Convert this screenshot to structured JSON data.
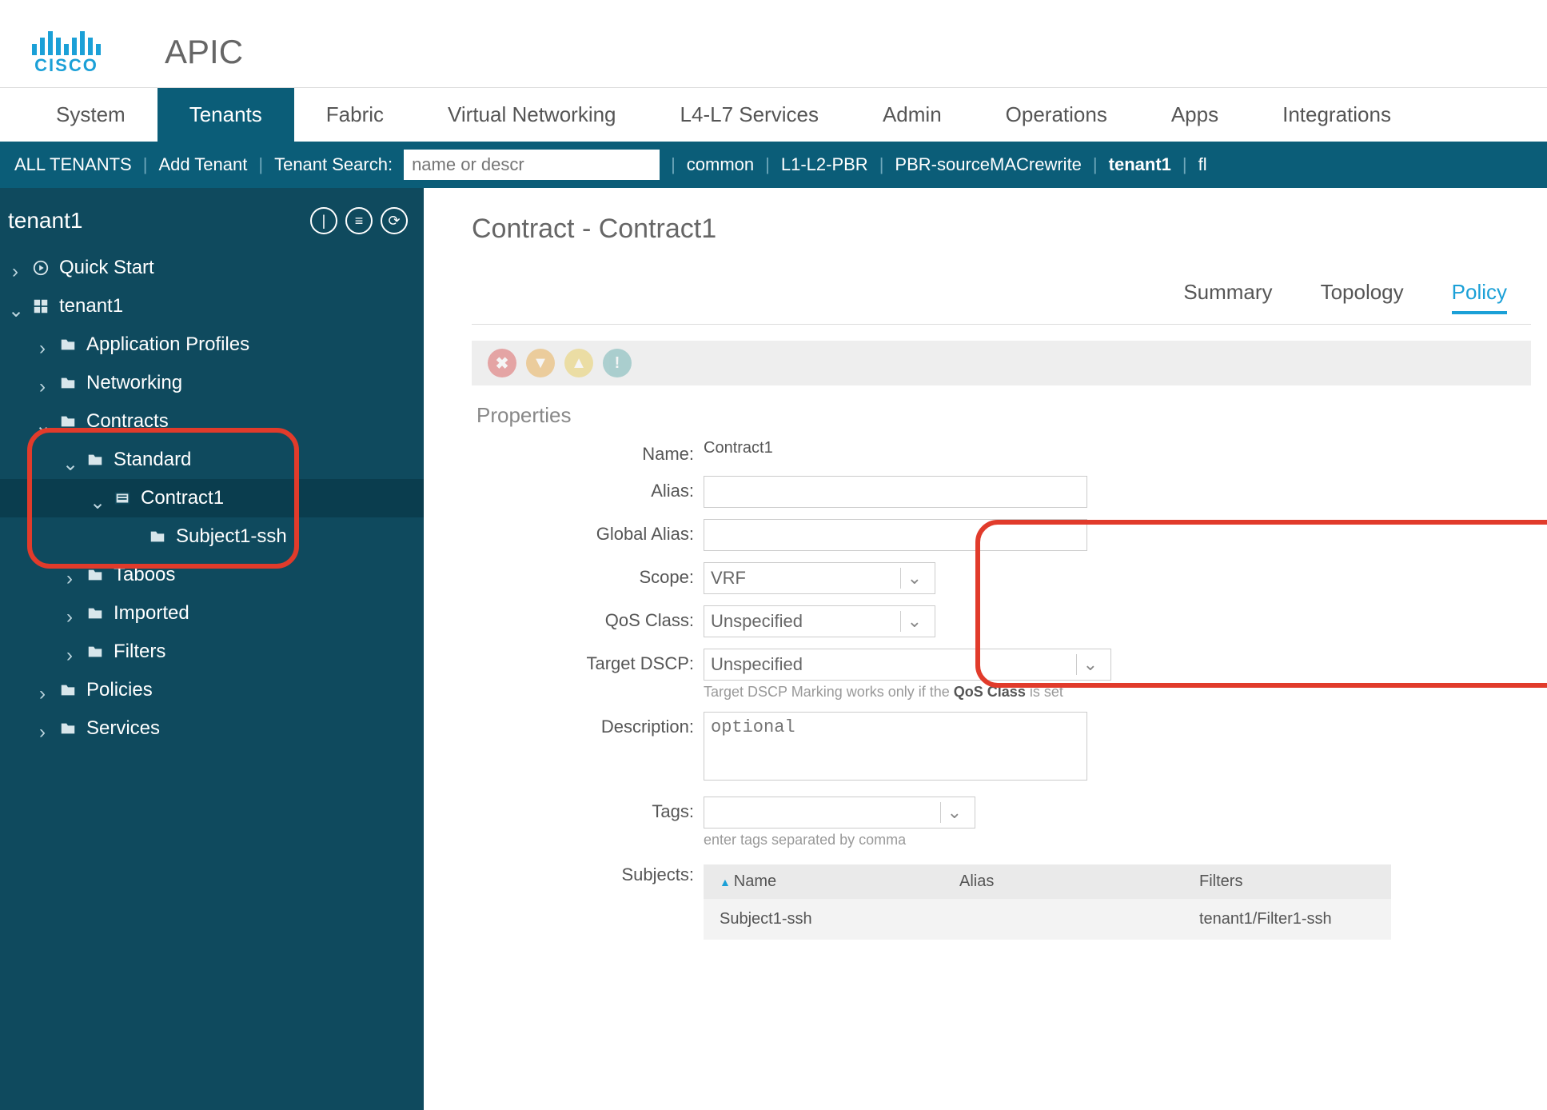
{
  "header": {
    "brand": "CISCO",
    "app": "APIC"
  },
  "topnav": [
    "System",
    "Tenants",
    "Fabric",
    "Virtual Networking",
    "L4-L7 Services",
    "Admin",
    "Operations",
    "Apps",
    "Integrations"
  ],
  "topnav_active": "Tenants",
  "subbar": {
    "all": "ALL TENANTS",
    "add": "Add Tenant",
    "search_label": "Tenant Search:",
    "search_placeholder": "name or descr",
    "links": [
      "common",
      "L1-L2-PBR",
      "PBR-sourceMACrewrite",
      "tenant1",
      "fl"
    ],
    "bold_link": "tenant1"
  },
  "sidebar": {
    "title": "tenant1",
    "items": [
      {
        "label": "Quick Start",
        "indent": 0,
        "icon": "quick",
        "caret": "right"
      },
      {
        "label": "tenant1",
        "indent": 0,
        "icon": "grid",
        "caret": "down"
      },
      {
        "label": "Application Profiles",
        "indent": 1,
        "icon": "folder",
        "caret": "right"
      },
      {
        "label": "Networking",
        "indent": 1,
        "icon": "folder",
        "caret": "right"
      },
      {
        "label": "Contracts",
        "indent": 1,
        "icon": "folder",
        "caret": "down"
      },
      {
        "label": "Standard",
        "indent": 2,
        "icon": "folder",
        "caret": "down"
      },
      {
        "label": "Contract1",
        "indent": 3,
        "icon": "contract",
        "caret": "down",
        "selected": true
      },
      {
        "label": "Subject1-ssh",
        "indent": 4,
        "icon": "folder",
        "caret": "none"
      },
      {
        "label": "Taboos",
        "indent": 2,
        "icon": "folder",
        "caret": "right"
      },
      {
        "label": "Imported",
        "indent": 2,
        "icon": "folder",
        "caret": "right"
      },
      {
        "label": "Filters",
        "indent": 2,
        "icon": "folder",
        "caret": "right"
      },
      {
        "label": "Policies",
        "indent": 1,
        "icon": "folder",
        "caret": "right"
      },
      {
        "label": "Services",
        "indent": 1,
        "icon": "folder",
        "caret": "right"
      }
    ]
  },
  "content": {
    "title": "Contract - Contract1",
    "tabs": [
      "Summary",
      "Topology",
      "Policy"
    ],
    "active_tab": "Policy",
    "section": "Properties",
    "fields": {
      "name_label": "Name:",
      "name_value": "Contract1",
      "alias_label": "Alias:",
      "alias_value": "",
      "global_alias_label": "Global Alias:",
      "global_alias_value": "",
      "scope_label": "Scope:",
      "scope_value": "VRF",
      "qos_label": "QoS Class:",
      "qos_value": "Unspecified",
      "dscp_label": "Target DSCP:",
      "dscp_value": "Unspecified",
      "dscp_note_pre": "Target DSCP Marking works only if the ",
      "dscp_note_bold": "QoS Class",
      "dscp_note_post": " is set",
      "desc_label": "Description:",
      "desc_placeholder": "optional",
      "tags_label": "Tags:",
      "tags_note": "enter tags separated by comma",
      "subjects_label": "Subjects:"
    },
    "subjects": {
      "cols": [
        "Name",
        "Alias",
        "Filters"
      ],
      "rows": [
        {
          "name": "Subject1-ssh",
          "alias": "",
          "filters": "tenant1/Filter1-ssh"
        }
      ]
    }
  }
}
